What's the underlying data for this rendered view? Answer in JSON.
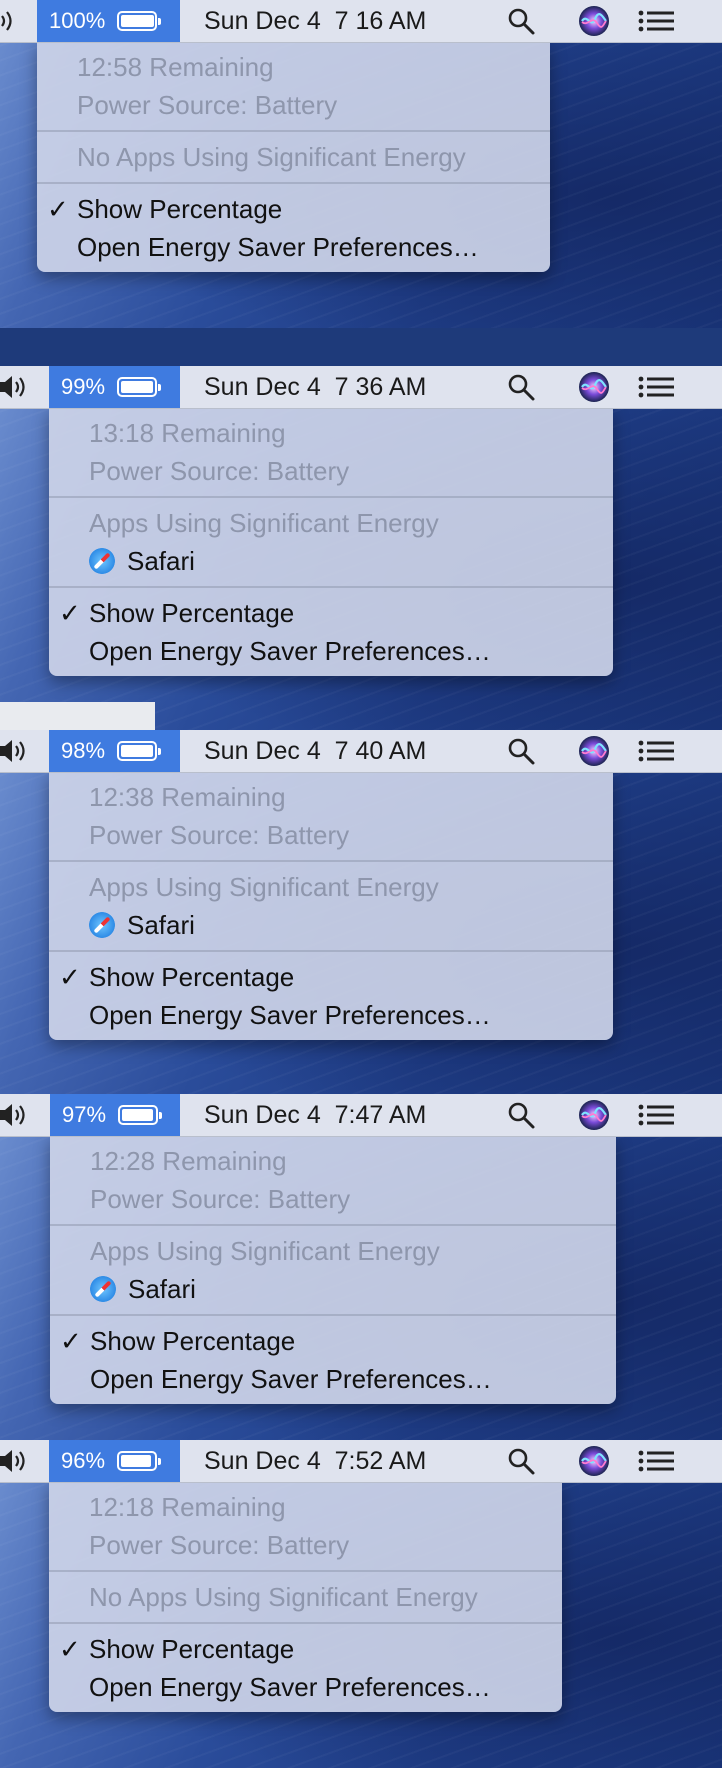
{
  "snapshots": [
    {
      "battery_pct": "100%",
      "time": "Sun Dec 4  7 16 AM",
      "remaining": "12:58 Remaining",
      "power_source": "Power Source: Battery",
      "energy_header": "No Apps Using Significant Energy",
      "apps": [],
      "show_pct": "Show Percentage",
      "open_prefs": "Open Energy Saver Preferences…",
      "check": "✓"
    },
    {
      "battery_pct": "99%",
      "time": "Sun Dec 4  7 36 AM",
      "remaining": "13:18 Remaining",
      "power_source": "Power Source: Battery",
      "energy_header": "Apps Using Significant Energy",
      "apps": [
        "Safari"
      ],
      "show_pct": "Show Percentage",
      "open_prefs": "Open Energy Saver Preferences…",
      "check": "✓"
    },
    {
      "battery_pct": "98%",
      "time": "Sun Dec 4  7 40 AM",
      "remaining": "12:38 Remaining",
      "power_source": "Power Source: Battery",
      "energy_header": "Apps Using Significant Energy",
      "apps": [
        "Safari"
      ],
      "show_pct": "Show Percentage",
      "open_prefs": "Open Energy Saver Preferences…",
      "check": "✓"
    },
    {
      "battery_pct": "97%",
      "time": "Sun Dec 4  7:47 AM",
      "remaining": "12:28 Remaining",
      "power_source": "Power Source: Battery",
      "energy_header": "Apps Using Significant Energy",
      "apps": [
        "Safari"
      ],
      "show_pct": "Show Percentage",
      "open_prefs": "Open Energy Saver Preferences…",
      "check": "✓"
    },
    {
      "battery_pct": "96%",
      "time": "Sun Dec 4  7:52 AM",
      "remaining": "12:18 Remaining",
      "power_source": "Power Source: Battery",
      "energy_header": "No Apps Using Significant Energy",
      "apps": [],
      "show_pct": "Show Percentage",
      "open_prefs": "Open Energy Saver Preferences…",
      "check": "✓"
    }
  ],
  "icons": {
    "speaker": "speaker-icon",
    "search": "search-icon",
    "siri": "siri-icon",
    "list": "notification-list-icon",
    "battery": "battery-icon",
    "safari": "safari-icon"
  },
  "colors": {
    "menubar_bg": "#dfe3ee",
    "battery_highlight": "#3f7be0",
    "menu_bg": "#cdd4e8",
    "disabled_text": "#8e96ac"
  }
}
